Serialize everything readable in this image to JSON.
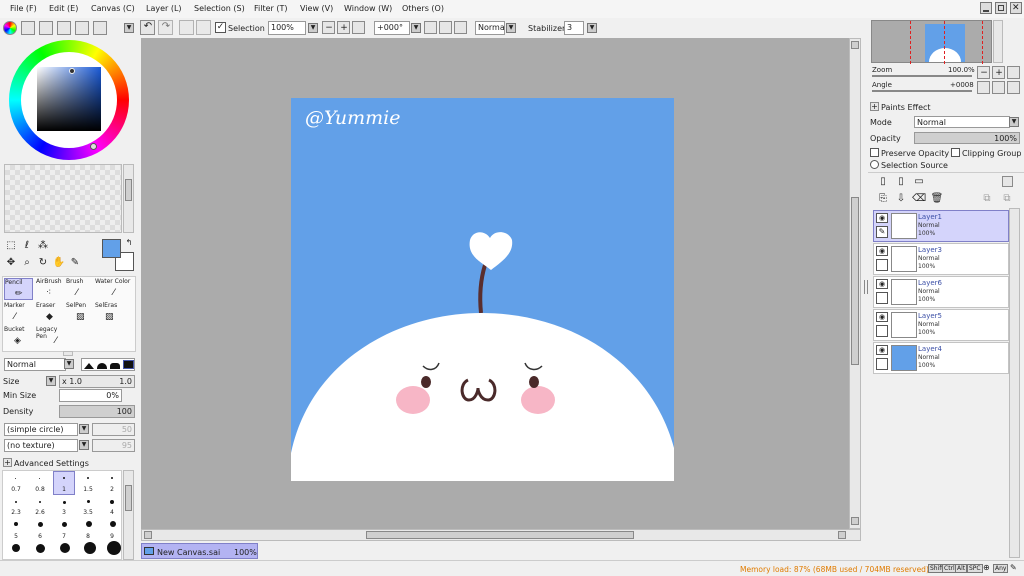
{
  "menu": {
    "items": [
      "File (F)",
      "Edit (E)",
      "Canvas (C)",
      "Layer (L)",
      "Selection (S)",
      "Filter (T)",
      "View (V)",
      "Window (W)",
      "Others (O)"
    ]
  },
  "toolbar": {
    "selection_label": "Selection",
    "zoom_value": "100%",
    "angle_value": "+000°",
    "blend_value": "Normal",
    "stabilizer_label": "Stabilizer",
    "stabilizer_value": "3"
  },
  "tools": {
    "row1": [
      "Pencil",
      "AirBrush",
      "Brush",
      "Water Color"
    ],
    "row2": [
      "Marker",
      "Eraser",
      "SelPen",
      "SelEras"
    ],
    "row3": [
      "Bucket",
      "Legacy Pen"
    ]
  },
  "brush": {
    "blend_mode": "Normal",
    "size_label": "Size",
    "size_mult": "x 1.0",
    "size_value": "1.0",
    "min_size_label": "Min Size",
    "min_size_value": "0%",
    "density_label": "Density",
    "density_value": "100",
    "shape": "(simple circle)",
    "shape_value": "50",
    "texture": "(no texture)",
    "texture_value": "95",
    "advanced_label": "Advanced Settings",
    "sizes_row1": [
      "0.7",
      "0.8",
      "1",
      "1.5",
      "2"
    ],
    "sizes_row2": [
      "2.3",
      "2.6",
      "3",
      "3.5",
      "4"
    ],
    "sizes_row3": [
      "5",
      "6",
      "7",
      "8",
      "9"
    ],
    "selected_size": "1"
  },
  "canvas": {
    "watermark": "@Yummie",
    "bg_color": "#62a0e8",
    "tab_name": "New Canvas.sai",
    "tab_zoom": "100%"
  },
  "navigator": {
    "zoom_label": "Zoom",
    "zoom_value": "100.0%",
    "angle_label": "Angle",
    "angle_value": "+0008"
  },
  "layer_props": {
    "paints_effect": "Paints Effect",
    "mode_label": "Mode",
    "mode_value": "Normal",
    "opacity_label": "Opacity",
    "opacity_value": "100%",
    "preserve_opacity": "Preserve Opacity",
    "clipping_group": "Clipping Group",
    "selection_source": "Selection Source"
  },
  "layers": [
    {
      "name": "Layer1",
      "mode": "Normal",
      "opacity": "100%",
      "selected": true
    },
    {
      "name": "Layer3",
      "mode": "Normal",
      "opacity": "100%",
      "selected": false
    },
    {
      "name": "Layer6",
      "mode": "Normal",
      "opacity": "100%",
      "selected": false
    },
    {
      "name": "Layer5",
      "mode": "Normal",
      "opacity": "100%",
      "selected": false
    },
    {
      "name": "Layer4",
      "mode": "Normal",
      "opacity": "100%",
      "selected": false
    }
  ],
  "status": {
    "memory": "Memory load: 87% (68MB used / 704MB reserved)",
    "keys": [
      "Shift",
      "Ctrl",
      "Alt",
      "SPC",
      "Any"
    ]
  },
  "colors": {
    "accent": "#62a0e8",
    "selection": "#d4d4fb",
    "memory_text": "#e07b00"
  }
}
